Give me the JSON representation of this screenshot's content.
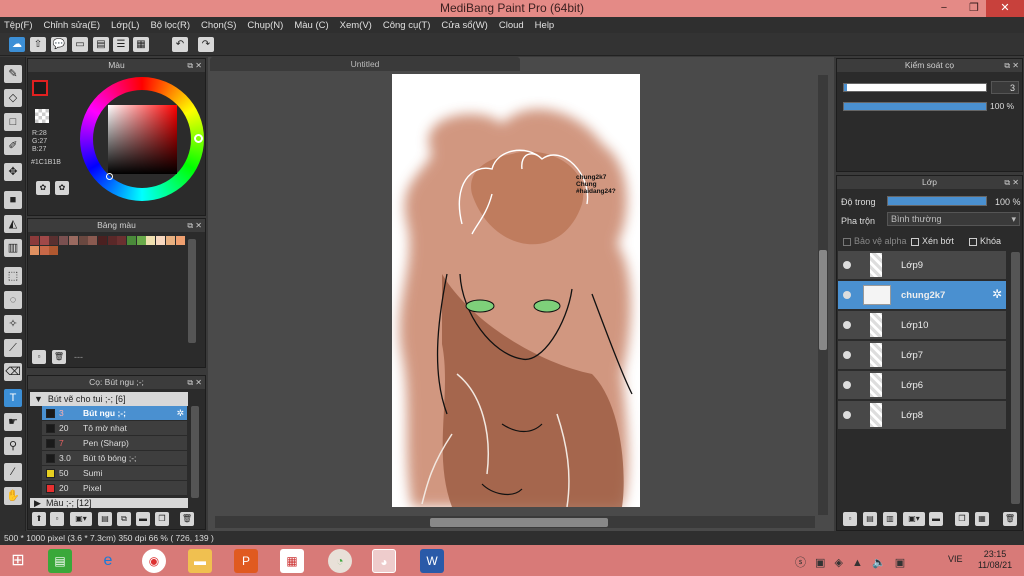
{
  "window": {
    "title": "MediBang Paint Pro (64bit)",
    "minimize": "−",
    "maximize": "❐",
    "close": "✕"
  },
  "menu": [
    "Tệp(F)",
    "Chỉnh sửa(E)",
    "Lớp(L)",
    "Bộ lọc(R)",
    "Chọn(S)",
    "Chụp(N)",
    "Màu (C)",
    "Xem(V)",
    "Công cụ(T)",
    "Cửa sổ(W)",
    "Cloud",
    "Help"
  ],
  "color_panel": {
    "title": "Màu",
    "r": "R:28",
    "g": "G:27",
    "b": "B:27",
    "hex": "#1C1B1B",
    "primary": "#1c1b1b",
    "secondary": "#8ab4e0"
  },
  "palette_panel": {
    "title": "Bảng màu",
    "colors": [
      "#8b3a3a",
      "#a04848",
      "#5a3030",
      "#7a5050",
      "#9a6a60",
      "#6a4840",
      "#8a5a50",
      "#4a2020",
      "#5a2828",
      "#6a3030",
      "#4a8a3a",
      "#6aaa4a",
      "#f0e0b0",
      "#f8d8c0",
      "#e8b080",
      "#f0a070",
      "#e09060",
      "#c86848",
      "#b05830"
    ],
    "dash": "---"
  },
  "brush_panel": {
    "title": "Cọ: Bút ngu ;-;",
    "group": "Bút vẽ cho tui ;-; [6]",
    "group2": "Màu ;-; [12]",
    "items": [
      {
        "size": "3",
        "name": "Bút ngu ;-;",
        "color": "#1a1a1a",
        "selected": true
      },
      {
        "size": "20",
        "name": "Tô mờ nhạt",
        "color": "#1a1a1a",
        "selected": false
      },
      {
        "size": "7",
        "name": "Pen (Sharp)",
        "color": "#1a1a1a",
        "selected": false
      },
      {
        "size": "3.0",
        "name": "Bút tô bóng ;-;",
        "color": "#1a1a1a",
        "selected": false
      },
      {
        "size": "50",
        "name": "Sumi",
        "color": "#e8d020",
        "selected": false
      },
      {
        "size": "20",
        "name": "Pixel",
        "color": "#e83030",
        "selected": false
      }
    ]
  },
  "canvas": {
    "tab": "Untitled",
    "note": "chung2k7\nChung\n#haidang24?"
  },
  "brush_control": {
    "title": "Kiểm soát cọ",
    "size": "3",
    "opacity": "100 %"
  },
  "layer_panel": {
    "title": "Lớp",
    "opacity_label": "Độ trong",
    "opacity_value": "100 %",
    "blend_label": "Pha trộn",
    "blend_value": "Bình thường",
    "protect_alpha": "Bảo vệ alpha",
    "clipping": "Xén bớt",
    "lock": "Khóa",
    "layers": [
      {
        "name": "Lớp9",
        "selected": false
      },
      {
        "name": "chung2k7",
        "selected": true
      },
      {
        "name": "Lớp10",
        "selected": false
      },
      {
        "name": "Lớp7",
        "selected": false
      },
      {
        "name": "Lớp6",
        "selected": false
      },
      {
        "name": "Lớp8",
        "selected": false
      }
    ]
  },
  "status": {
    "text": "500 * 1000 pixel  (3.6 * 7.3cm)  350 dpi  66 %  ( 726, 139 )"
  },
  "taskbar": {
    "lang": "VIE",
    "time": "23:15",
    "date": "11/08/21"
  }
}
